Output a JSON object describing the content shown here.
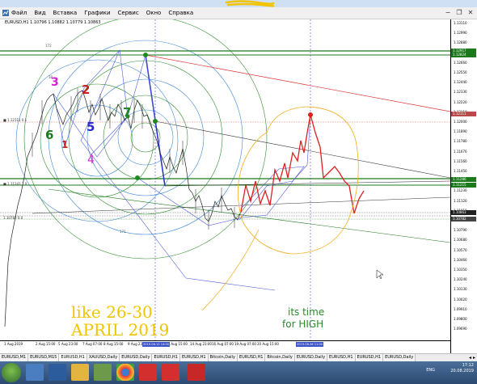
{
  "menu": {
    "items": [
      "Файл",
      "Вид",
      "Вставка",
      "Графики",
      "Сервис",
      "Окно",
      "Справка"
    ]
  },
  "window_buttons": [
    "−",
    "❐",
    "✕"
  ],
  "chart": {
    "title": "EURUSD,H1  1.10796 1.10882 1.10779 1.10863",
    "price_labels": [
      "1.13110",
      "1.12990",
      "1.12880",
      "1.12770",
      "1.12660",
      "1.12550",
      "1.12440",
      "1.12330",
      "1.12220",
      "1.12110",
      "1.12000",
      "1.11890",
      "1.11780",
      "1.11670",
      "1.11560",
      "1.11450",
      "1.11340",
      "1.11230",
      "1.11120",
      "1.11010",
      "1.10900",
      "1.10790",
      "1.10680",
      "1.10570",
      "1.10460",
      "1.10350",
      "1.10240",
      "1.10130",
      "1.10020",
      "1.09910",
      "1.09800",
      "1.09690"
    ],
    "price_boxes": [
      {
        "text": "1.12917",
        "color": "#1c7a1c"
      },
      {
        "text": "1.12824",
        "color": "#1c7a1c"
      },
      {
        "text": "1.12111",
        "color": "#b84a4a"
      },
      {
        "text": "1.11286",
        "color": "#1c7a1c"
      },
      {
        "text": "1.11215",
        "color": "#1c7a1c"
      },
      {
        "text": "1.10863",
        "color": "#222222"
      },
      {
        "text": "1.10782",
        "color": "#444444"
      }
    ],
    "time_labels": [
      "1 Aug 2019",
      "2 Aug 15:00",
      "5 Aug 23:00",
      "7 Aug 07:00",
      "8 Aug 15:00",
      "9 Aug 23:00",
      "13 Aug 15:00",
      "14 Aug 23:00",
      "16 Aug 07:00",
      "19 Aug 07:00",
      "20 Aug 15:00"
    ],
    "time_boxes": [
      "2019.08.12 14:00",
      "2019.08.26 11:00"
    ],
    "wave_labels": [
      {
        "text": "3",
        "color": "#d61fd6"
      },
      {
        "text": "2",
        "color": "#c81e1e"
      },
      {
        "text": "7",
        "color": "#1c8a1c"
      },
      {
        "text": "6",
        "color": "#1c7a1c"
      },
      {
        "text": "1",
        "color": "#c81e1e"
      },
      {
        "text": "5",
        "color": "#2a2ad0"
      },
      {
        "text": "4",
        "color": "#d61fd6"
      }
    ],
    "handwritten": {
      "line1": "like 26-30",
      "line2": "APRIL 2019",
      "note1": "its  time",
      "note2": "for  HIGH"
    }
  },
  "tabs": [
    "EURUSD,M1",
    "EURUSD,M15",
    "EURUSD,H1",
    "XAUUSD,Daily",
    "EURUSD,Daily",
    "EURUSD,H1",
    "EURUSD,H1",
    "Bitcoin,Daily",
    "EURUSD,H1",
    "Bitcoin,Daily",
    "EURUSD,Daily",
    "EURUSD,H1",
    "EURUSD,H1",
    "EURUSD,Daily"
  ],
  "active_tab": 2,
  "tray": {
    "lang": "ENG",
    "time": "17:12",
    "date": "20.08.2019"
  }
}
